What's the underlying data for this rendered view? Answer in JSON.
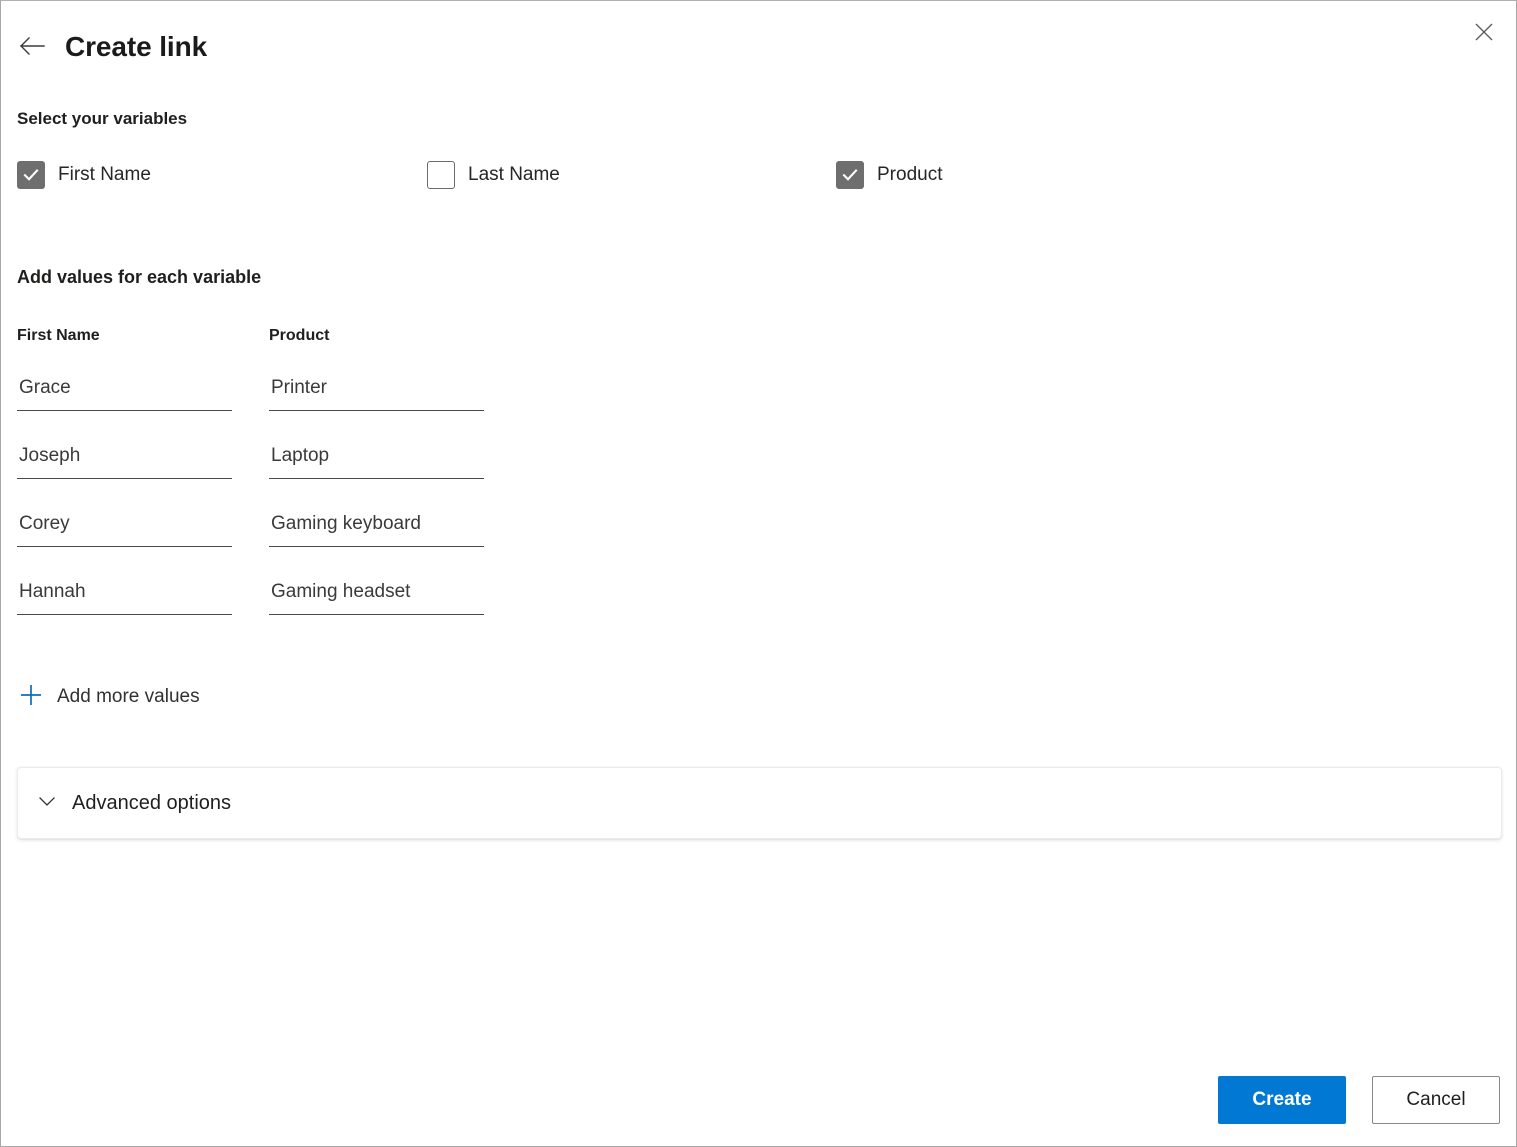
{
  "window": {
    "close_icon": "close-icon"
  },
  "header": {
    "back_icon": "arrow-left-icon",
    "title": "Create link"
  },
  "variables_section": {
    "heading": "Select your variables",
    "checkboxes": [
      {
        "label": "First Name",
        "checked": true
      },
      {
        "label": "Last Name",
        "checked": false
      },
      {
        "label": "Product",
        "checked": true
      }
    ]
  },
  "values_section": {
    "heading": "Add values for each variable",
    "columns": [
      {
        "header": "First Name",
        "values": [
          "Grace",
          "Joseph",
          "Corey",
          "Hannah"
        ]
      },
      {
        "header": "Product",
        "values": [
          "Printer",
          "Laptop",
          "Gaming keyboard",
          "Gaming headset"
        ]
      }
    ],
    "add_more_label": "Add more values",
    "add_more_icon": "plus-icon"
  },
  "advanced_options": {
    "label": "Advanced options",
    "icon": "chevron-down-icon",
    "expanded": false
  },
  "footer": {
    "primary_label": "Create",
    "secondary_label": "Cancel"
  },
  "colors": {
    "accent": "#0078d4",
    "checkbox_fill": "#6e6e6e",
    "text_primary": "#201f1e",
    "border": "#a8a8a8"
  }
}
